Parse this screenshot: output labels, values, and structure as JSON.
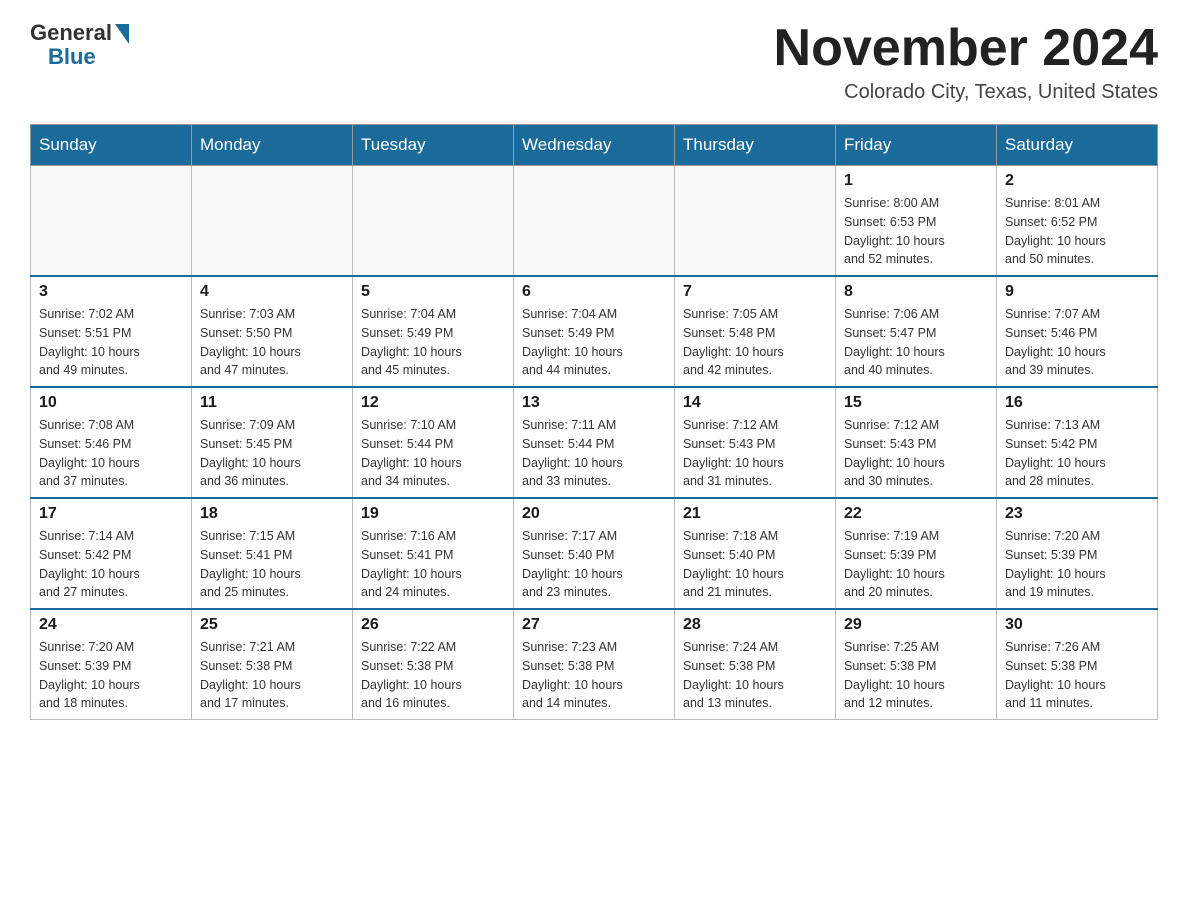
{
  "header": {
    "logo_general": "General",
    "logo_blue": "Blue",
    "month_title": "November 2024",
    "location": "Colorado City, Texas, United States"
  },
  "weekdays": [
    "Sunday",
    "Monday",
    "Tuesday",
    "Wednesday",
    "Thursday",
    "Friday",
    "Saturday"
  ],
  "weeks": [
    [
      {
        "day": "",
        "info": ""
      },
      {
        "day": "",
        "info": ""
      },
      {
        "day": "",
        "info": ""
      },
      {
        "day": "",
        "info": ""
      },
      {
        "day": "",
        "info": ""
      },
      {
        "day": "1",
        "info": "Sunrise: 8:00 AM\nSunset: 6:53 PM\nDaylight: 10 hours\nand 52 minutes."
      },
      {
        "day": "2",
        "info": "Sunrise: 8:01 AM\nSunset: 6:52 PM\nDaylight: 10 hours\nand 50 minutes."
      }
    ],
    [
      {
        "day": "3",
        "info": "Sunrise: 7:02 AM\nSunset: 5:51 PM\nDaylight: 10 hours\nand 49 minutes."
      },
      {
        "day": "4",
        "info": "Sunrise: 7:03 AM\nSunset: 5:50 PM\nDaylight: 10 hours\nand 47 minutes."
      },
      {
        "day": "5",
        "info": "Sunrise: 7:04 AM\nSunset: 5:49 PM\nDaylight: 10 hours\nand 45 minutes."
      },
      {
        "day": "6",
        "info": "Sunrise: 7:04 AM\nSunset: 5:49 PM\nDaylight: 10 hours\nand 44 minutes."
      },
      {
        "day": "7",
        "info": "Sunrise: 7:05 AM\nSunset: 5:48 PM\nDaylight: 10 hours\nand 42 minutes."
      },
      {
        "day": "8",
        "info": "Sunrise: 7:06 AM\nSunset: 5:47 PM\nDaylight: 10 hours\nand 40 minutes."
      },
      {
        "day": "9",
        "info": "Sunrise: 7:07 AM\nSunset: 5:46 PM\nDaylight: 10 hours\nand 39 minutes."
      }
    ],
    [
      {
        "day": "10",
        "info": "Sunrise: 7:08 AM\nSunset: 5:46 PM\nDaylight: 10 hours\nand 37 minutes."
      },
      {
        "day": "11",
        "info": "Sunrise: 7:09 AM\nSunset: 5:45 PM\nDaylight: 10 hours\nand 36 minutes."
      },
      {
        "day": "12",
        "info": "Sunrise: 7:10 AM\nSunset: 5:44 PM\nDaylight: 10 hours\nand 34 minutes."
      },
      {
        "day": "13",
        "info": "Sunrise: 7:11 AM\nSunset: 5:44 PM\nDaylight: 10 hours\nand 33 minutes."
      },
      {
        "day": "14",
        "info": "Sunrise: 7:12 AM\nSunset: 5:43 PM\nDaylight: 10 hours\nand 31 minutes."
      },
      {
        "day": "15",
        "info": "Sunrise: 7:12 AM\nSunset: 5:43 PM\nDaylight: 10 hours\nand 30 minutes."
      },
      {
        "day": "16",
        "info": "Sunrise: 7:13 AM\nSunset: 5:42 PM\nDaylight: 10 hours\nand 28 minutes."
      }
    ],
    [
      {
        "day": "17",
        "info": "Sunrise: 7:14 AM\nSunset: 5:42 PM\nDaylight: 10 hours\nand 27 minutes."
      },
      {
        "day": "18",
        "info": "Sunrise: 7:15 AM\nSunset: 5:41 PM\nDaylight: 10 hours\nand 25 minutes."
      },
      {
        "day": "19",
        "info": "Sunrise: 7:16 AM\nSunset: 5:41 PM\nDaylight: 10 hours\nand 24 minutes."
      },
      {
        "day": "20",
        "info": "Sunrise: 7:17 AM\nSunset: 5:40 PM\nDaylight: 10 hours\nand 23 minutes."
      },
      {
        "day": "21",
        "info": "Sunrise: 7:18 AM\nSunset: 5:40 PM\nDaylight: 10 hours\nand 21 minutes."
      },
      {
        "day": "22",
        "info": "Sunrise: 7:19 AM\nSunset: 5:39 PM\nDaylight: 10 hours\nand 20 minutes."
      },
      {
        "day": "23",
        "info": "Sunrise: 7:20 AM\nSunset: 5:39 PM\nDaylight: 10 hours\nand 19 minutes."
      }
    ],
    [
      {
        "day": "24",
        "info": "Sunrise: 7:20 AM\nSunset: 5:39 PM\nDaylight: 10 hours\nand 18 minutes."
      },
      {
        "day": "25",
        "info": "Sunrise: 7:21 AM\nSunset: 5:38 PM\nDaylight: 10 hours\nand 17 minutes."
      },
      {
        "day": "26",
        "info": "Sunrise: 7:22 AM\nSunset: 5:38 PM\nDaylight: 10 hours\nand 16 minutes."
      },
      {
        "day": "27",
        "info": "Sunrise: 7:23 AM\nSunset: 5:38 PM\nDaylight: 10 hours\nand 14 minutes."
      },
      {
        "day": "28",
        "info": "Sunrise: 7:24 AM\nSunset: 5:38 PM\nDaylight: 10 hours\nand 13 minutes."
      },
      {
        "day": "29",
        "info": "Sunrise: 7:25 AM\nSunset: 5:38 PM\nDaylight: 10 hours\nand 12 minutes."
      },
      {
        "day": "30",
        "info": "Sunrise: 7:26 AM\nSunset: 5:38 PM\nDaylight: 10 hours\nand 11 minutes."
      }
    ]
  ]
}
